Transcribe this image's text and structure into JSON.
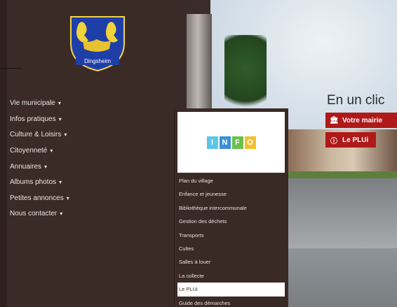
{
  "crest": {
    "caption": "Dingsheim"
  },
  "nav": {
    "items": [
      {
        "label": "Vie municipale",
        "caret": "▾"
      },
      {
        "label": "Infos pratiques",
        "caret": "▾"
      },
      {
        "label": "Culture & Loisirs",
        "caret": "▾"
      },
      {
        "label": "Citoyenneté",
        "caret": "▾"
      },
      {
        "label": "Annuaires",
        "caret": "▾"
      },
      {
        "label": "Albums photos",
        "caret": "▾"
      },
      {
        "label": "Petites annonces",
        "caret": "▾"
      },
      {
        "label": "Nous contacter",
        "caret": "▾"
      }
    ]
  },
  "dropdown": {
    "logo_letters": [
      "I",
      "N",
      "F",
      "O"
    ],
    "items": [
      {
        "label": "Plan du village"
      },
      {
        "label": "Enfance et jeunesse"
      },
      {
        "label": "Bibliothèque intercommunale"
      },
      {
        "label": "Gestion des déchets"
      },
      {
        "label": "Transports"
      },
      {
        "label": "Cultes"
      },
      {
        "label": "Salles à louer"
      },
      {
        "label": "La collecte"
      },
      {
        "label": "Le PLUi"
      },
      {
        "label": "Guide des démarches"
      }
    ],
    "active_index": 8
  },
  "cta": {
    "title": "En un clic",
    "buttons": [
      {
        "label": "Votre mairie",
        "icon": "bank-icon"
      },
      {
        "label": "Le PLUi",
        "icon": "info-icon"
      }
    ]
  },
  "colors": {
    "panel": "#3b2b27",
    "accent_red": "#b01919",
    "text_light": "#eae4df",
    "info_blue": "#5cc6e8",
    "info_blue2": "#3a8fd6",
    "info_green": "#6cc04a",
    "info_yellow": "#f2c12e"
  }
}
